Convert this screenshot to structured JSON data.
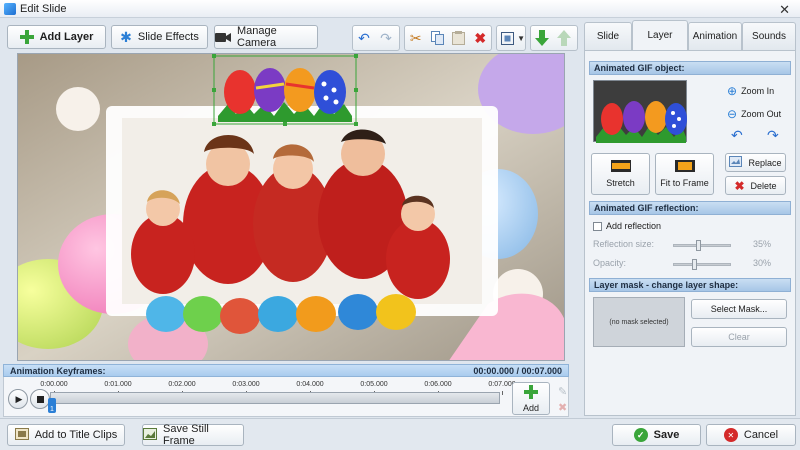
{
  "window": {
    "title": "Edit Slide",
    "close_icon": "close-icon"
  },
  "toolbar": {
    "add_layer": "Add Layer",
    "slide_effects": "Slide Effects",
    "manage_camera": "Manage Camera"
  },
  "tabs": [
    {
      "label": "Slide",
      "active": false
    },
    {
      "label": "Layer",
      "active": true
    },
    {
      "label": "Animation",
      "active": false
    },
    {
      "label": "Sounds",
      "active": false
    }
  ],
  "gif_object": {
    "header": "Animated GIF object:",
    "zoom_in": "Zoom In",
    "zoom_out": "Zoom Out",
    "stretch": "Stretch",
    "fit_to_frame": "Fit to Frame",
    "replace": "Replace",
    "delete": "Delete"
  },
  "gif_reflection": {
    "header": "Animated GIF reflection:",
    "add_reflection": "Add reflection",
    "reflection_size_label": "Reflection size:",
    "reflection_size_value": "35%",
    "opacity_label": "Opacity:",
    "opacity_value": "30%"
  },
  "layer_mask": {
    "header": "Layer mask - change layer shape:",
    "no_mask": "(no mask selected)",
    "select_mask": "Select Mask...",
    "clear": "Clear"
  },
  "keyframes": {
    "header": "Animation Keyframes:",
    "time": "00:00.000 / 00:07.000",
    "ticks": [
      "0:00.000",
      "0:01.000",
      "0:02.000",
      "0:03.000",
      "0:04.000",
      "0:05.000",
      "0:06.000",
      "0:07.000"
    ],
    "keyframe_marker": "1",
    "add": "Add"
  },
  "bottom": {
    "add_to_title_clips": "Add to Title Clips",
    "save_still_frame": "Save Still Frame",
    "save": "Save",
    "cancel": "Cancel"
  },
  "colors": {
    "accent_blue": "#3b8fe0",
    "egg_red": "#e8332e",
    "egg_purple": "#7b3bc4",
    "egg_orange": "#f39a1f",
    "egg_blue": "#2f4fd8",
    "save_green": "#3aa53a",
    "cancel_red": "#d42a2a"
  }
}
